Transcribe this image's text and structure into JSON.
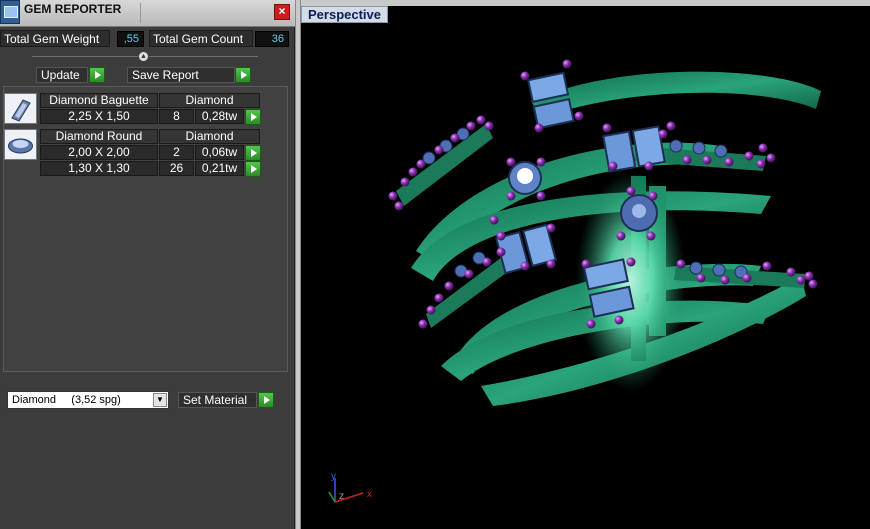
{
  "window": {
    "title": "GEM REPORTER",
    "close_glyph": "×"
  },
  "stats": {
    "weight_label": "Total Gem Weight",
    "weight_value": ",55",
    "count_label": "Total Gem Count",
    "count_value": "36"
  },
  "actions": {
    "update_label": "Update",
    "save_label": "Save Report"
  },
  "gems": [
    {
      "icon": "baguette-gem-icon",
      "shape": "Diamond Baguette",
      "material": "Diamond",
      "rows": [
        {
          "size": "2,25 X 1,50",
          "count": "8",
          "weight": "0,28tw"
        }
      ]
    },
    {
      "icon": "round-gem-icon",
      "shape": "Diamond Round",
      "material": "Diamond",
      "rows": [
        {
          "size": "2,00 X 2,00",
          "count": "2",
          "weight": "0,06tw"
        },
        {
          "size": "1,30 X 1,30",
          "count": "26",
          "weight": "0,21tw"
        }
      ]
    }
  ],
  "material": {
    "selected": "Diamond     (3,52 spg)",
    "set_label": "Set Material"
  },
  "viewport": {
    "label": "Perspective",
    "axes": {
      "x": "x",
      "y": "y",
      "z": "z"
    },
    "colors": {
      "metal": "#1f8f68",
      "metal_highlight": "#7ef3c8",
      "prong": "#8a2fb0",
      "baguette": "#7aa9e6",
      "round": "#5f83c9"
    }
  }
}
